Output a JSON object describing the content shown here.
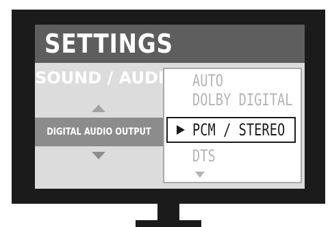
{
  "settings": {
    "title": "SETTINGS",
    "section": "SOUND / AUDIO",
    "current_setting": "DIGITAL AUDIO OUTPUT",
    "options": [
      {
        "label": "AUTO",
        "selected": false
      },
      {
        "label": "DOLBY DIGITAL",
        "selected": false
      },
      {
        "label": "PCM / STEREO",
        "selected": true
      },
      {
        "label": "DTS",
        "selected": false
      }
    ]
  },
  "icons": {
    "setting_up": "triangle-up-icon",
    "setting_down": "triangle-down-icon",
    "selected_marker": "triangle-right-icon",
    "list_more": "triangle-down-icon"
  },
  "colors": {
    "bezel": "#1b1b1b",
    "screen_bg": "#dcdcdc",
    "title_bar": "#5e5e5e",
    "highlight_row": "#8c8c8c",
    "option_inactive": "#b4b4b4",
    "option_active": "#1b1b1b"
  }
}
